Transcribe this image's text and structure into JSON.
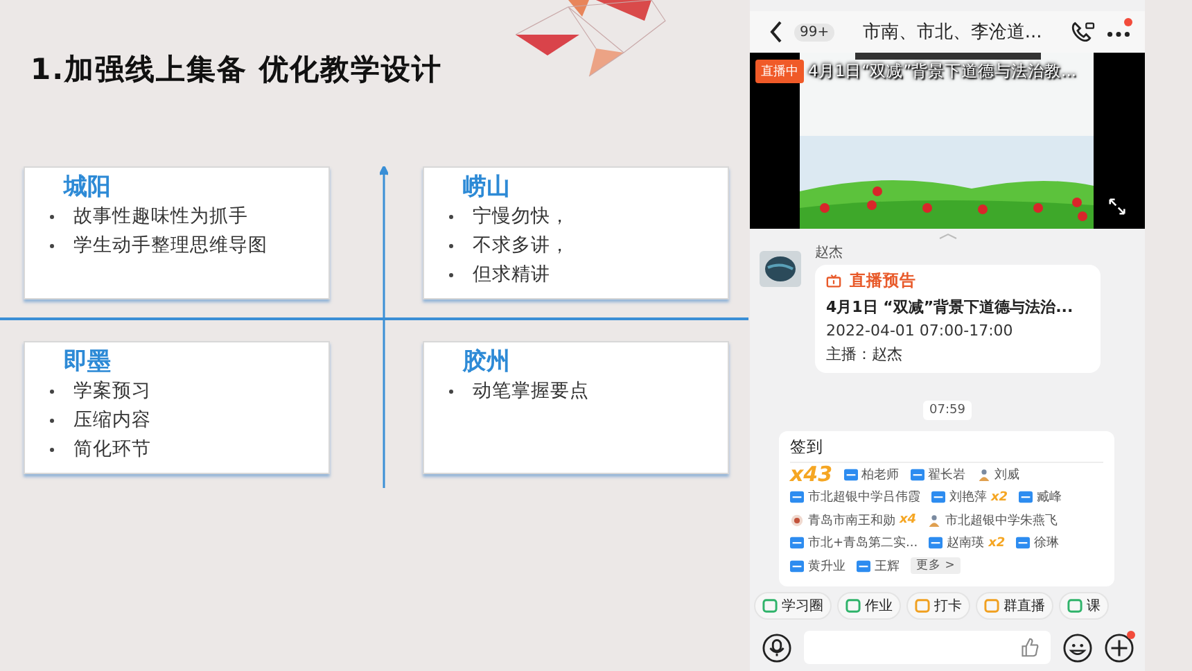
{
  "slide": {
    "title": "1.加强线上集备  优化教学设计",
    "quadrants": [
      {
        "name": "城阳",
        "points": [
          "故事性趣味性为抓手",
          "学生动手整理思维导图"
        ]
      },
      {
        "name": "崂山",
        "points": [
          "宁慢勿快，",
          "不求多讲，",
          "但求精讲"
        ]
      },
      {
        "name": "即墨",
        "points": [
          "学案预习",
          "压缩内容",
          "简化环节"
        ]
      },
      {
        "name": "胶州",
        "points": [
          "动笔掌握要点"
        ]
      }
    ]
  },
  "phone": {
    "header": {
      "badge": "99+",
      "title": "市南、市北、李沧道...",
      "notification": true
    },
    "video": {
      "status": "直播中",
      "title": "4月1日“双减”背景下道德与法治教..."
    },
    "message": {
      "sender": "赵杰",
      "label": "直播预告",
      "title": "4月1日 “双减”背景下道德与法治...",
      "time": "2022-04-01 07:00-17:00",
      "host": "主播：赵杰"
    },
    "timestamp": "07:59",
    "checkin": {
      "title": "签到",
      "count": "x43",
      "lines": [
        {
          "entries": [
            {
              "kind": "tag",
              "name": "柏老师"
            },
            {
              "kind": "tag",
              "name": "翟长岩"
            },
            {
              "kind": "figure",
              "name": "刘威"
            }
          ]
        },
        {
          "entries": [
            {
              "kind": "tag",
              "name": "市北超银中学吕伟霞"
            },
            {
              "kind": "tag",
              "name": "刘艳萍",
              "multiplier": "x2"
            },
            {
              "kind": "tag",
              "name": "臧峰"
            }
          ]
        },
        {
          "entries": [
            {
              "kind": "emblem",
              "name": "青岛市南王和勋",
              "multiplier": "x4"
            },
            {
              "kind": "figure",
              "name": "市北超银中学朱燕飞"
            }
          ]
        },
        {
          "entries": [
            {
              "kind": "tag",
              "name": "市北+青岛第二实..."
            },
            {
              "kind": "tag",
              "name": "赵南瑛",
              "multiplier": "x2"
            },
            {
              "kind": "tag",
              "name": "徐琳"
            }
          ]
        },
        {
          "entries": [
            {
              "kind": "tag",
              "name": "黄升业"
            },
            {
              "kind": "tag",
              "name": "王辉"
            }
          ]
        }
      ],
      "more": "更多 >"
    },
    "tools": [
      {
        "label": "学习圈",
        "color": "#2fb36a"
      },
      {
        "label": "作业",
        "color": "#2fb36a"
      },
      {
        "label": "打卡",
        "color": "#f0a020"
      },
      {
        "label": "群直播",
        "color": "#f0a020"
      },
      {
        "label": "课",
        "color": "#2fb36a"
      }
    ],
    "composer": {
      "notification": true
    }
  }
}
